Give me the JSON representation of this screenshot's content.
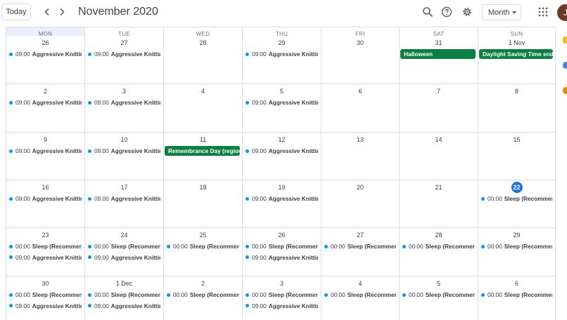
{
  "toolbar": {
    "today_label": "Today",
    "title": "November 2020",
    "view_label": "Month",
    "avatar_initial": "J"
  },
  "weekdays": [
    "MON",
    "TUE",
    "WED",
    "THU",
    "FRI",
    "SAT",
    "SUN"
  ],
  "today_marker": "22",
  "event_color": "#039be5",
  "holiday_color": "#0b8043",
  "weeks": [
    [
      {
        "day": "26",
        "events": [
          {
            "time": "09:00",
            "name": "Aggressive Knitting"
          }
        ]
      },
      {
        "day": "27",
        "events": [
          {
            "time": "09:00",
            "name": "Aggressive Knitting"
          }
        ]
      },
      {
        "day": "28",
        "events": []
      },
      {
        "day": "29",
        "events": [
          {
            "time": "09:00",
            "name": "Aggressive Knitting"
          }
        ]
      },
      {
        "day": "30",
        "events": []
      },
      {
        "day": "31",
        "allday": "Halloween",
        "events": []
      },
      {
        "day": "1 Nov",
        "allday": "Daylight Saving Time ends",
        "events": []
      }
    ],
    [
      {
        "day": "2",
        "events": [
          {
            "time": "09:00",
            "name": "Aggressive Knitting"
          }
        ]
      },
      {
        "day": "3",
        "events": [
          {
            "time": "09:00",
            "name": "Aggressive Knitting"
          }
        ]
      },
      {
        "day": "4",
        "events": []
      },
      {
        "day": "5",
        "events": [
          {
            "time": "09:00",
            "name": "Aggressive Knitting"
          }
        ]
      },
      {
        "day": "6",
        "events": []
      },
      {
        "day": "7",
        "events": []
      },
      {
        "day": "8",
        "events": []
      }
    ],
    [
      {
        "day": "9",
        "events": [
          {
            "time": "09:00",
            "name": "Aggressive Knitting"
          }
        ]
      },
      {
        "day": "10",
        "events": [
          {
            "time": "09:00",
            "name": "Aggressive Knitting"
          }
        ]
      },
      {
        "day": "11",
        "allday": "Remembrance Day (regiona",
        "events": []
      },
      {
        "day": "12",
        "events": [
          {
            "time": "09:00",
            "name": "Aggressive Knitting"
          }
        ]
      },
      {
        "day": "13",
        "events": []
      },
      {
        "day": "14",
        "events": []
      },
      {
        "day": "15",
        "events": []
      }
    ],
    [
      {
        "day": "16",
        "events": [
          {
            "time": "09:00",
            "name": "Aggressive Knitting"
          }
        ]
      },
      {
        "day": "17",
        "events": [
          {
            "time": "09:00",
            "name": "Aggressive Knitting"
          }
        ]
      },
      {
        "day": "18",
        "events": []
      },
      {
        "day": "19",
        "events": [
          {
            "time": "09:00",
            "name": "Aggressive Knitting"
          }
        ]
      },
      {
        "day": "20",
        "events": []
      },
      {
        "day": "21",
        "events": []
      },
      {
        "day": "22",
        "events": [
          {
            "time": "00:00",
            "name": "Sleep (Recommende"
          }
        ]
      }
    ],
    [
      {
        "day": "23",
        "events": [
          {
            "time": "00:00",
            "name": "Sleep (Recommende"
          },
          {
            "time": "09:00",
            "name": "Aggressive Knitting"
          }
        ]
      },
      {
        "day": "24",
        "events": [
          {
            "time": "00:00",
            "name": "Sleep (Recommende"
          },
          {
            "time": "09:00",
            "name": "Aggressive Knitting"
          }
        ]
      },
      {
        "day": "25",
        "events": [
          {
            "time": "00:00",
            "name": "Sleep (Recommende"
          }
        ]
      },
      {
        "day": "26",
        "events": [
          {
            "time": "00:00",
            "name": "Sleep (Recommende"
          },
          {
            "time": "09:00",
            "name": "Aggressive Knitting"
          }
        ]
      },
      {
        "day": "27",
        "events": [
          {
            "time": "00:00",
            "name": "Sleep (Recommende"
          }
        ]
      },
      {
        "day": "28",
        "events": [
          {
            "time": "00:00",
            "name": "Sleep (Recommende"
          }
        ]
      },
      {
        "day": "29",
        "events": [
          {
            "time": "00:00",
            "name": "Sleep (Recommende"
          }
        ]
      }
    ],
    [
      {
        "day": "30",
        "events": [
          {
            "time": "00:00",
            "name": "Sleep (Recommende"
          },
          {
            "time": "09:00",
            "name": "Aggressive Knitting"
          }
        ]
      },
      {
        "day": "1 Dec",
        "events": [
          {
            "time": "00:00",
            "name": "Sleep (Recommende"
          },
          {
            "time": "09:00",
            "name": "Aggressive Knitting"
          }
        ]
      },
      {
        "day": "2",
        "events": [
          {
            "time": "00:00",
            "name": "Sleep (Recommende"
          }
        ]
      },
      {
        "day": "3",
        "events": [
          {
            "time": "00:00",
            "name": "Sleep (Recommende"
          },
          {
            "time": "09:00",
            "name": "Aggressive Knitting"
          }
        ]
      },
      {
        "day": "4",
        "events": [
          {
            "time": "00:00",
            "name": "Sleep (Recommende"
          }
        ]
      },
      {
        "day": "5",
        "events": [
          {
            "time": "00:00",
            "name": "Sleep (Recommende"
          }
        ]
      },
      {
        "day": "6",
        "events": [
          {
            "time": "00:00",
            "name": "Sleep (Recommende"
          }
        ]
      }
    ]
  ]
}
